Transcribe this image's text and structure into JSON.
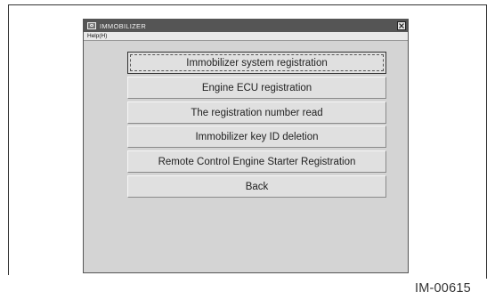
{
  "window": {
    "title": "IMMOBILIZER",
    "icon": "app-icon",
    "close_icon": "close-icon"
  },
  "menubar": {
    "items": [
      {
        "label": "Help(H)"
      }
    ]
  },
  "buttons": [
    {
      "label": "Immobilizer system registration",
      "focused": true
    },
    {
      "label": "Engine ECU registration",
      "focused": false
    },
    {
      "label": "The registration number read",
      "focused": false
    },
    {
      "label": "Immobilizer key ID deletion",
      "focused": false
    },
    {
      "label": "Remote Control Engine Starter Registration",
      "focused": false
    },
    {
      "label": "Back",
      "focused": false
    }
  ],
  "figure": {
    "caption": "IM-00615"
  }
}
